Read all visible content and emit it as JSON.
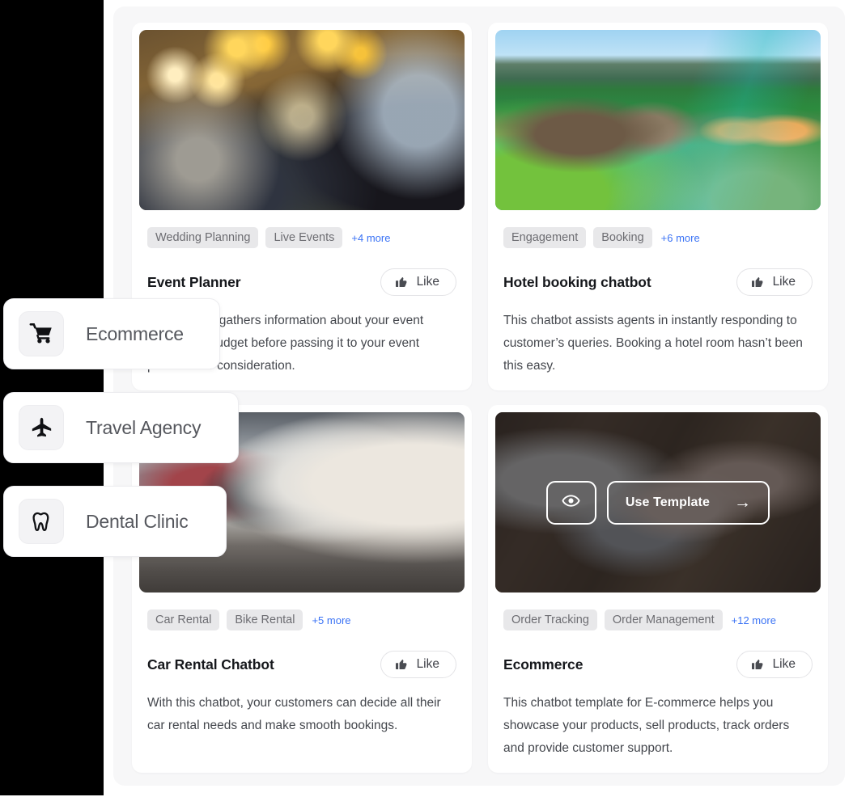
{
  "layout": {
    "panel_bg": "#f7f7f8",
    "card_bg": "#ffffff",
    "accent_link": "#3b73f5",
    "tag_bg": "#e8e8ea",
    "sidebar_bg": "#000000"
  },
  "category_overlay": {
    "items": [
      {
        "label": "Ecommerce",
        "icon": "shopping-cart-icon"
      },
      {
        "label": "Travel Agency",
        "icon": "airplane-icon"
      },
      {
        "label": "Dental Clinic",
        "icon": "tooth-icon"
      }
    ]
  },
  "gallery": {
    "like_label": "Like",
    "use_template_label": "Use Template",
    "use_template_arrow": "→",
    "cards": [
      {
        "title": "Event Planner",
        "image": "wedding-celebration-photo",
        "tags": [
          "Wedding Planning",
          "Live Events"
        ],
        "more": "+4 more",
        "description": "This chatbot gathers information about your event needs and budget before passing it to your event planners for consideration.",
        "like_label": "Like",
        "hovered": false
      },
      {
        "title": "Hotel booking chatbot",
        "image": "tropical-resort-pool-photo",
        "tags": [
          "Engagement",
          "Booking"
        ],
        "more": "+6 more",
        "description": "This chatbot assists agents in instantly responding to customer’s queries. Booking a hotel room hasn’t been this easy.",
        "like_label": "Like",
        "hovered": false
      },
      {
        "title": "Car Rental Chatbot",
        "image": "car-lot-photo",
        "tags": [
          "Car Rental",
          "Bike Rental"
        ],
        "more": "+5 more",
        "description": "With this chatbot, your customers can decide all their car rental needs and make smooth bookings.",
        "like_label": "Like",
        "hovered": false
      },
      {
        "title": "Ecommerce",
        "image": "laptop-typing-photo",
        "tags": [
          "Order Tracking",
          "Order Management"
        ],
        "more": "+12 more",
        "description": "This chatbot template for E-commerce helps you showcase your products, sell products, track orders and provide customer support.",
        "like_label": "Like",
        "hovered": true
      }
    ]
  }
}
